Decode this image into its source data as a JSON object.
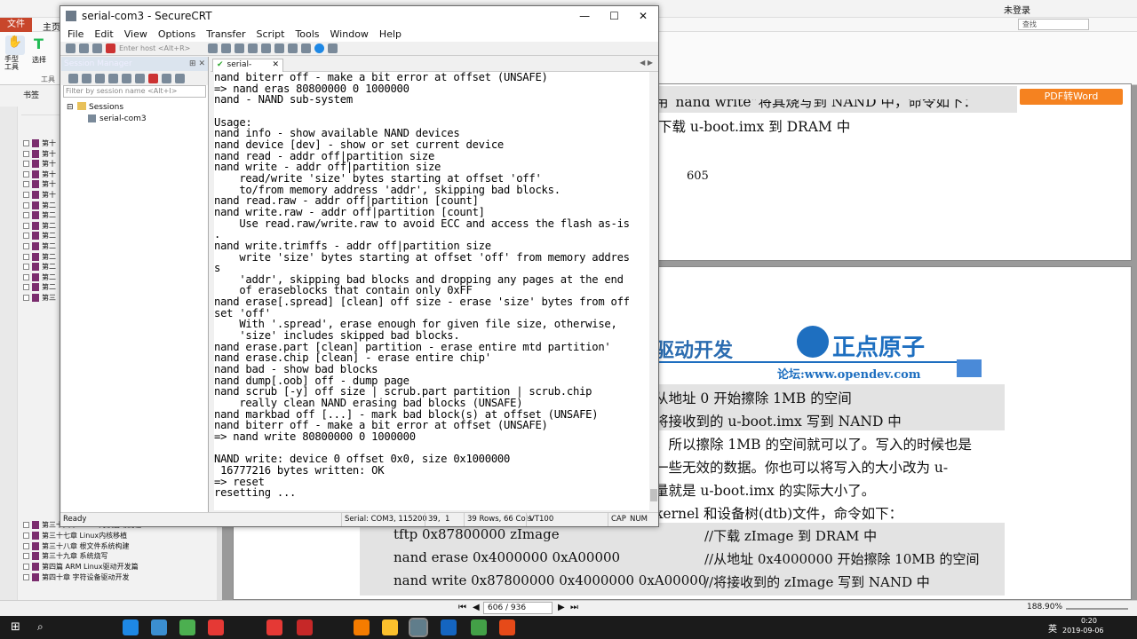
{
  "pdf": {
    "tabs": {
      "file": "文件",
      "home": "主页"
    },
    "top_right": {
      "not_logged_in": "未登录",
      "search_placeholder": "查找"
    },
    "left_tools": {
      "hand": "手型\n工具",
      "select": "选择",
      "tools": "工具"
    },
    "bookmark_header": "书签",
    "pdf_to_word": "PDF转Word",
    "bookmarks_short": [
      "第十",
      "第十",
      "第十",
      "第十",
      "第十",
      "第十",
      "第二",
      "第二",
      "第二",
      "第二",
      "第二",
      "第二",
      "第二",
      "第二",
      "第二",
      "第三"
    ],
    "bookmarks_full": [
      "第三十六章 Linux内核启动流程",
      "第三十七章 Linux内核移植",
      "第三十八章 根文件系统构建",
      "第三十九章 系统烧写",
      "第四篇 ARM Linux驱动开发篇",
      "第四十章 字符设备驱动开发"
    ],
    "page1_lines": [
      "用“nand write”将其烧写到 NAND 中，命令如下：",
      "下载 u-boot.imx 到 DRAM 中",
      "605"
    ],
    "page2": {
      "header_left": "驱动开发",
      "logo_text": "正点原子",
      "forum": "论坛:www.opendev.com",
      "lines": [
        "从地址 0 开始擦除 1MB 的空间",
        "将接收到的 u-boot.imx 写到 NAND 中",
        "，所以擦除 1MB 的空间就可以了。写入的时候也是",
        "一些无效的数据。你也可以将写入的大小改为  u-",
        "量就是 u-boot.imx 的实际大小了。",
        "kernel 和设备树(dtb)文件，命令如下："
      ],
      "code_rows": [
        {
          "cmd": "tftp 0x87800000 zImage",
          "comment": "//下载 zImage 到 DRAM 中"
        },
        {
          "cmd": "nand erase 0x4000000 0xA00000",
          "comment": "//从地址 0x4000000 开始擦除 10MB 的空间"
        },
        {
          "cmd": "nand write 0x87800000 0x4000000 0xA00000",
          "comment": "//将接收到的 zImage 写到 NAND 中"
        }
      ]
    },
    "status": {
      "page": "606 / 936",
      "zoom": "188.90%"
    },
    "clock": {
      "time": "0:20",
      "date": "2019-09-06"
    },
    "ime": "英"
  },
  "crt": {
    "title": "serial-com3 - SecureCRT",
    "menu": [
      "File",
      "Edit",
      "View",
      "Options",
      "Transfer",
      "Script",
      "Tools",
      "Window",
      "Help"
    ],
    "host_placeholder": "Enter host <Alt+R>",
    "session_manager": "Session Manager",
    "session_filter": "Filter by session name <Alt+I>",
    "tree": {
      "root": "Sessions",
      "child": "serial-com3"
    },
    "tab": "serial-com3",
    "terminal": "nand biterr off - make a bit error at offset (UNSAFE)\n=> nand eras 80800000 0 1000000\nnand - NAND sub-system\n\nUsage:\nnand info - show available NAND devices\nnand device [dev] - show or set current device\nnand read - addr off|partition size\nnand write - addr off|partition size\n    read/write 'size' bytes starting at offset 'off'\n    to/from memory address 'addr', skipping bad blocks.\nnand read.raw - addr off|partition [count]\nnand write.raw - addr off|partition [count]\n    Use read.raw/write.raw to avoid ECC and access the flash as-is\n.\nnand write.trimffs - addr off|partition size\n    write 'size' bytes starting at offset 'off' from memory addres\ns\n    'addr', skipping bad blocks and dropping any pages at the end\n    of eraseblocks that contain only 0xFF\nnand erase[.spread] [clean] off size - erase 'size' bytes from off\nset 'off'\n    With '.spread', erase enough for given file size, otherwise,\n    'size' includes skipped bad blocks.\nnand erase.part [clean] partition - erase entire mtd partition'\nnand erase.chip [clean] - erase entire chip'\nnand bad - show bad blocks\nnand dump[.oob] off - dump page\nnand scrub [-y] off size | scrub.part partition | scrub.chip\n    really clean NAND erasing bad blocks (UNSAFE)\nnand markbad off [...] - mark bad block(s) at offset (UNSAFE)\nnand biterr off - make a bit error at offset (UNSAFE)\n=> nand write 80800000 0 1000000\n\nNAND write: device 0 offset 0x0, size 0x1000000\n 16777216 bytes written: OK\n=> reset\nresetting ...",
    "status": {
      "ready": "Ready",
      "serial": "Serial: COM3, 115200",
      "row": "39,",
      "col": "1",
      "size": "39 Rows, 66 Cols",
      "term": "VT100",
      "caps": "CAP",
      "num": "NUM"
    }
  }
}
